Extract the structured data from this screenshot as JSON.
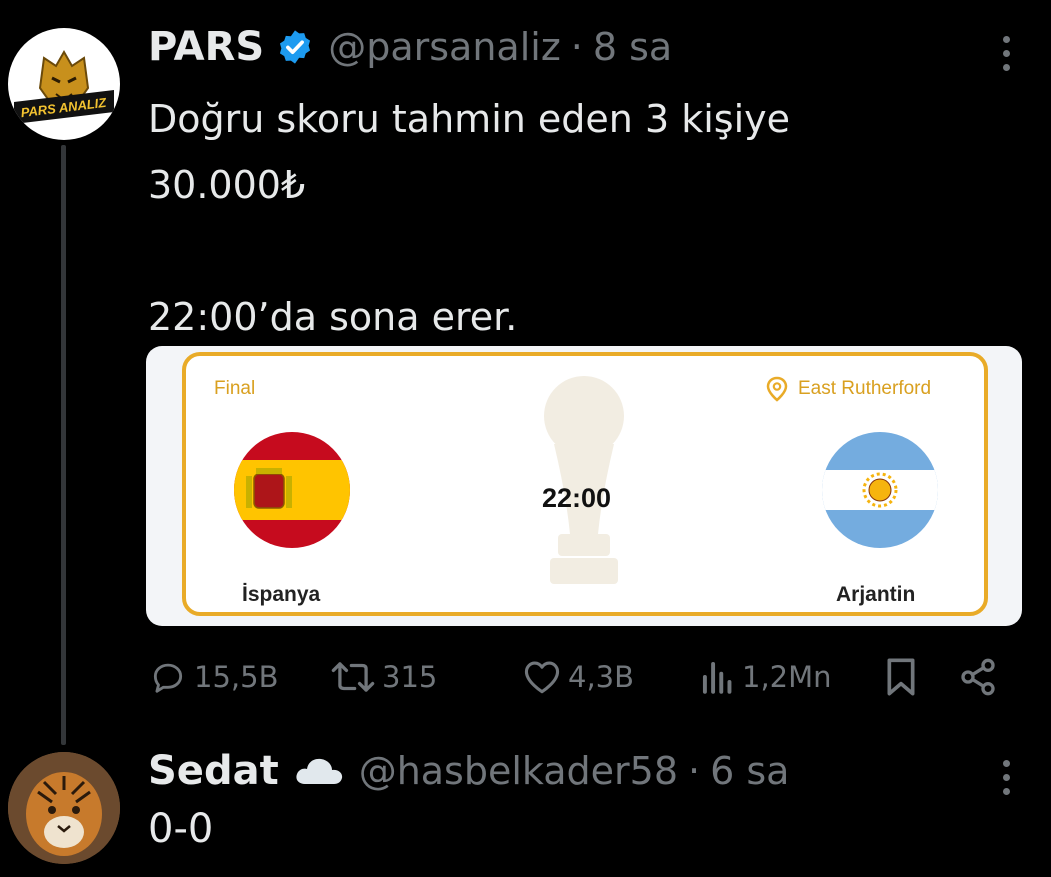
{
  "tweet": {
    "author_name": "PARS",
    "handle": "@parsanaliz",
    "separator": "·",
    "time": "8 sa",
    "text": "Doğru skoru tahmin eden 3 kişiye\n30.000₺\n\n22:00’da sona erer.",
    "avatar_text": "PARS ANALIZ",
    "verified_color": "#1d9bf0",
    "card": {
      "stage": "Final",
      "venue": "East Rutherford",
      "kickoff": "22:00",
      "home_team": "İspanya",
      "away_team": "Arjantin",
      "accent_color": "#e9ab28"
    },
    "actions": {
      "replies": "15,5B",
      "retweets": "315",
      "likes": "4,3B",
      "views": "1,2Mn"
    }
  },
  "reply": {
    "author_name": "Sedat",
    "name_emoji": "☁️",
    "handle": "@hasbelkader58",
    "separator": "·",
    "time": "6 sa",
    "text": "0-0"
  },
  "icons": [
    "verified-badge-icon",
    "more-icon",
    "location-pin-icon",
    "reply-icon",
    "retweet-icon",
    "like-icon",
    "views-icon",
    "bookmark-icon",
    "share-icon",
    "cloud-icon"
  ]
}
